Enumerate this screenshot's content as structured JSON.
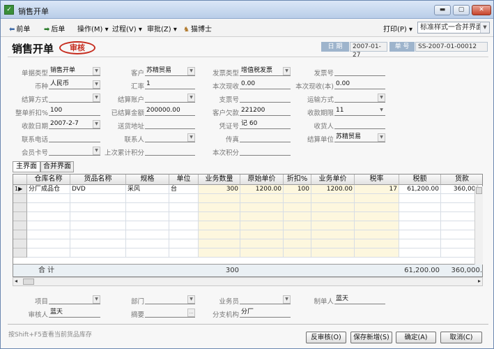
{
  "window": {
    "title": "销售开单"
  },
  "toolbar": {
    "prev": "前单",
    "next": "后单",
    "ops": "操作(M)",
    "process": "过程(V)",
    "approve": "审批(Z)",
    "assistant": "猫博士",
    "print": "打印(P)",
    "style_value": "标准样式一合并界面"
  },
  "heading": {
    "title": "销售开单",
    "stamp": "审核"
  },
  "headinfo": {
    "date_label": "日 期",
    "date_value": "2007-01-27",
    "doc_label": "单 号",
    "doc_value": "SS-2007-01-00012"
  },
  "fields": {
    "doc_type_label": "单据类型",
    "doc_type": "销售开单",
    "customer_label": "客户",
    "customer": "苏精贸易",
    "invoice_type_label": "发票类型",
    "invoice_type": "增值税发票",
    "invoice_no_label": "发票号",
    "invoice_no": "",
    "currency_label": "币种",
    "currency": "人民币",
    "rate_label": "汇率",
    "rate": "1",
    "received_label": "本次现收",
    "received": "0.00",
    "received_base_label": "本次现收(本)",
    "received_base": "0.00",
    "settle_label": "结算方式",
    "settle": "",
    "account_label": "结算账户",
    "account": "",
    "cheque_label": "支票号",
    "cheque": "",
    "shipping_label": "运输方式",
    "shipping": "",
    "discount_label": "整单折扣%",
    "discount": "100",
    "settled_label": "已结算金额",
    "settled": "200000.00",
    "owed_label": "客户欠款",
    "owed": "221200",
    "term_label": "收款期限",
    "term": "11",
    "collect_date_label": "收款日期",
    "collect_date": "2007-2-7",
    "ship_addr_label": "送货地址",
    "ship_addr": "",
    "voucher_label": "凭证号",
    "voucher": "记 60",
    "receiver_label": "收货人",
    "receiver": "",
    "phone_label": "联系电话",
    "phone": "",
    "contact_label": "联系人",
    "contact": "",
    "fax_label": "传真",
    "fax": "",
    "settle_unit_label": "结算单位",
    "settle_unit": "苏精贸易",
    "member_label": "会员卡号",
    "member": "",
    "points_prev_label": "上次累计积分",
    "points_prev": "",
    "points_label": "本次积分",
    "points": ""
  },
  "tabs": [
    "主界面",
    "合并界面"
  ],
  "grid": {
    "columns": [
      "仓库名称",
      "货品名称",
      "规格",
      "单位",
      "业务数量",
      "原始单价",
      "折扣%",
      "业务单价",
      "税率",
      "税额",
      "货款"
    ],
    "rows": [
      {
        "num": "1",
        "warehouse": "分厂成品仓",
        "product": "DVD",
        "spec": "采风",
        "unit": "台",
        "qty": "300",
        "orig_price": "1200.00",
        "discount": "100",
        "price": "1200.00",
        "tax_rate": "17",
        "tax": "61,200.00",
        "amount": "360,000."
      }
    ],
    "total_label": "合 计",
    "total_qty": "300",
    "total_tax": "61,200.00",
    "total_amount": "360,000."
  },
  "footer": {
    "item_label": "项目",
    "item": "",
    "dept_label": "部门",
    "dept": "",
    "salesman_label": "业务员",
    "salesman": "",
    "maker_label": "制单人",
    "maker": "蓝天",
    "reviewer_label": "审核人",
    "reviewer": "蓝天",
    "summary_label": "摘要",
    "summary": "",
    "branch_label": "分支机构",
    "branch": "分厂"
  },
  "status_text": "按Shift+F5查看当前货品库存",
  "buttons": {
    "unapprove": "反审核(O)",
    "save_new": "保存新增(S)",
    "ok": "确定(A)",
    "cancel": "取消(C)"
  }
}
